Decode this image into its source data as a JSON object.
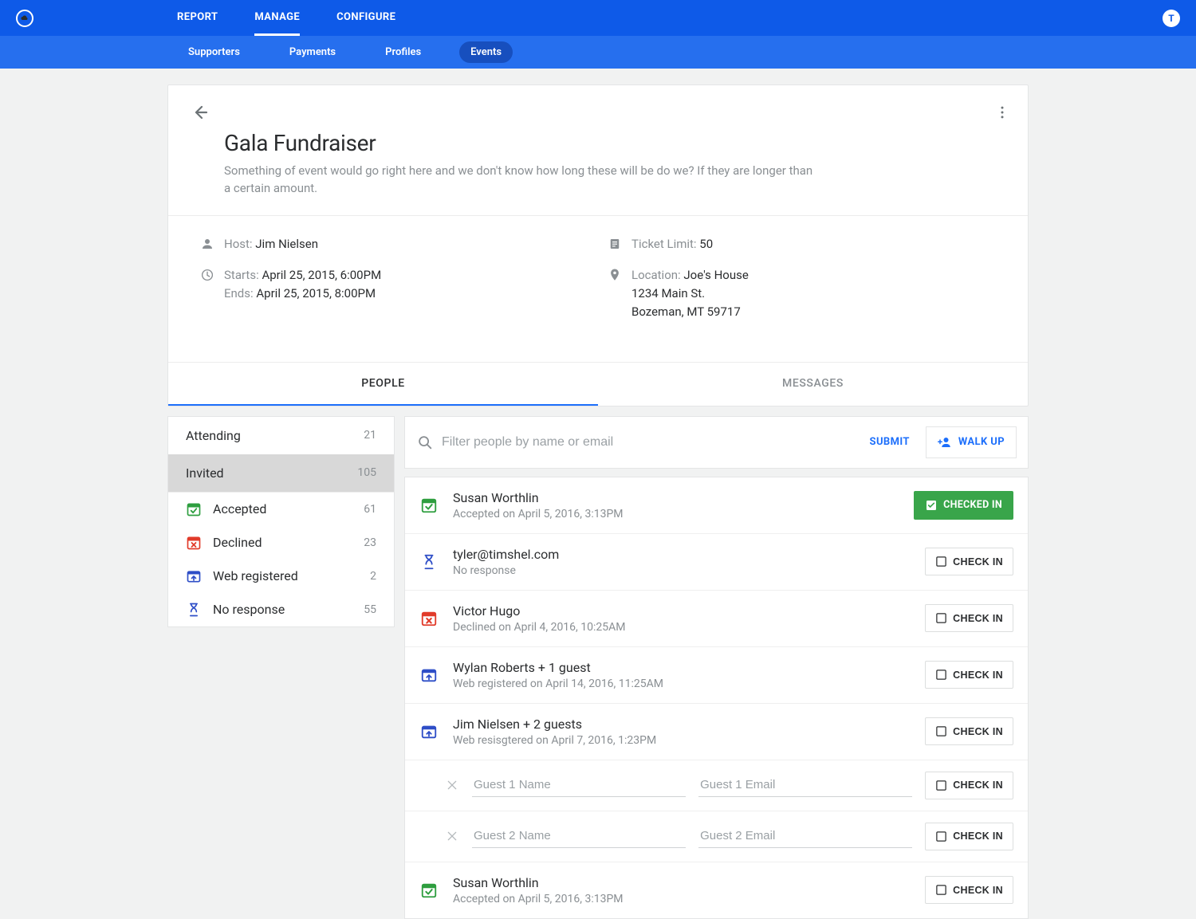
{
  "topnav": {
    "tabs": [
      "REPORT",
      "MANAGE",
      "CONFIGURE"
    ],
    "active": 1,
    "avatar_letter": "T"
  },
  "subnav": {
    "items": [
      "Supporters",
      "Payments",
      "Profiles",
      "Events"
    ],
    "active": 3
  },
  "event": {
    "title": "Gala Fundraiser",
    "description": "Something of event would go right here and we don't know how long these will be do we? If they are longer than a certain amount.",
    "host_label": "Host:",
    "host": "Jim Nielsen",
    "starts_label": "Starts:",
    "starts": "April 25, 2015, 6:00PM",
    "ends_label": "Ends:",
    "ends": "April 25, 2015, 8:00PM",
    "ticket_label": "Ticket Limit:",
    "ticket_limit": "50",
    "location_label": "Location:",
    "location_name": "Joe's House",
    "location_line1": "1234 Main St.",
    "location_line2": "Bozeman, MT 59717"
  },
  "tabs": {
    "people": "PEOPLE",
    "messages": "MESSAGES"
  },
  "sidebar": {
    "attending": {
      "label": "Attending",
      "count": "21"
    },
    "invited": {
      "label": "Invited",
      "count": "105"
    },
    "statuses": [
      {
        "icon": "accepted",
        "label": "Accepted",
        "count": "61"
      },
      {
        "icon": "declined",
        "label": "Declined",
        "count": "23"
      },
      {
        "icon": "web",
        "label": "Web registered",
        "count": "2"
      },
      {
        "icon": "noresp",
        "label": "No response",
        "count": "55"
      }
    ]
  },
  "filter": {
    "placeholder": "Filter people by name or email",
    "submit": "SUBMIT",
    "walkup": "WALK UP"
  },
  "buttons": {
    "checkin": "CHECK IN",
    "checkedin": "CHECKED IN"
  },
  "people": [
    {
      "icon": "accepted",
      "name": "Susan Worthlin",
      "sub": "Accepted on April 5, 2016, 3:13PM",
      "state": "checkedin"
    },
    {
      "icon": "noresp",
      "name": "tyler@timshel.com",
      "sub": "No response",
      "state": "checkin"
    },
    {
      "icon": "declined",
      "name": "Victor Hugo",
      "sub": "Declined on April 4, 2016, 10:25AM",
      "state": "checkin"
    },
    {
      "icon": "web",
      "name": "Wylan Roberts + 1 guest",
      "sub": "Web registered on April 14, 2016, 11:25AM",
      "state": "checkin"
    },
    {
      "icon": "web",
      "name": "Jim Nielsen + 2 guests",
      "sub": "Web resisgtered on April 7, 2016, 1:23PM",
      "state": "checkin"
    }
  ],
  "guests": [
    {
      "name_ph": "Guest 1 Name",
      "email_ph": "Guest 1 Email"
    },
    {
      "name_ph": "Guest 2 Name",
      "email_ph": "Guest 2 Email"
    }
  ],
  "trailing": {
    "icon": "accepted",
    "name": "Susan Worthlin",
    "sub": "Accepted on April 5, 2016, 3:13PM",
    "state": "checkin"
  }
}
